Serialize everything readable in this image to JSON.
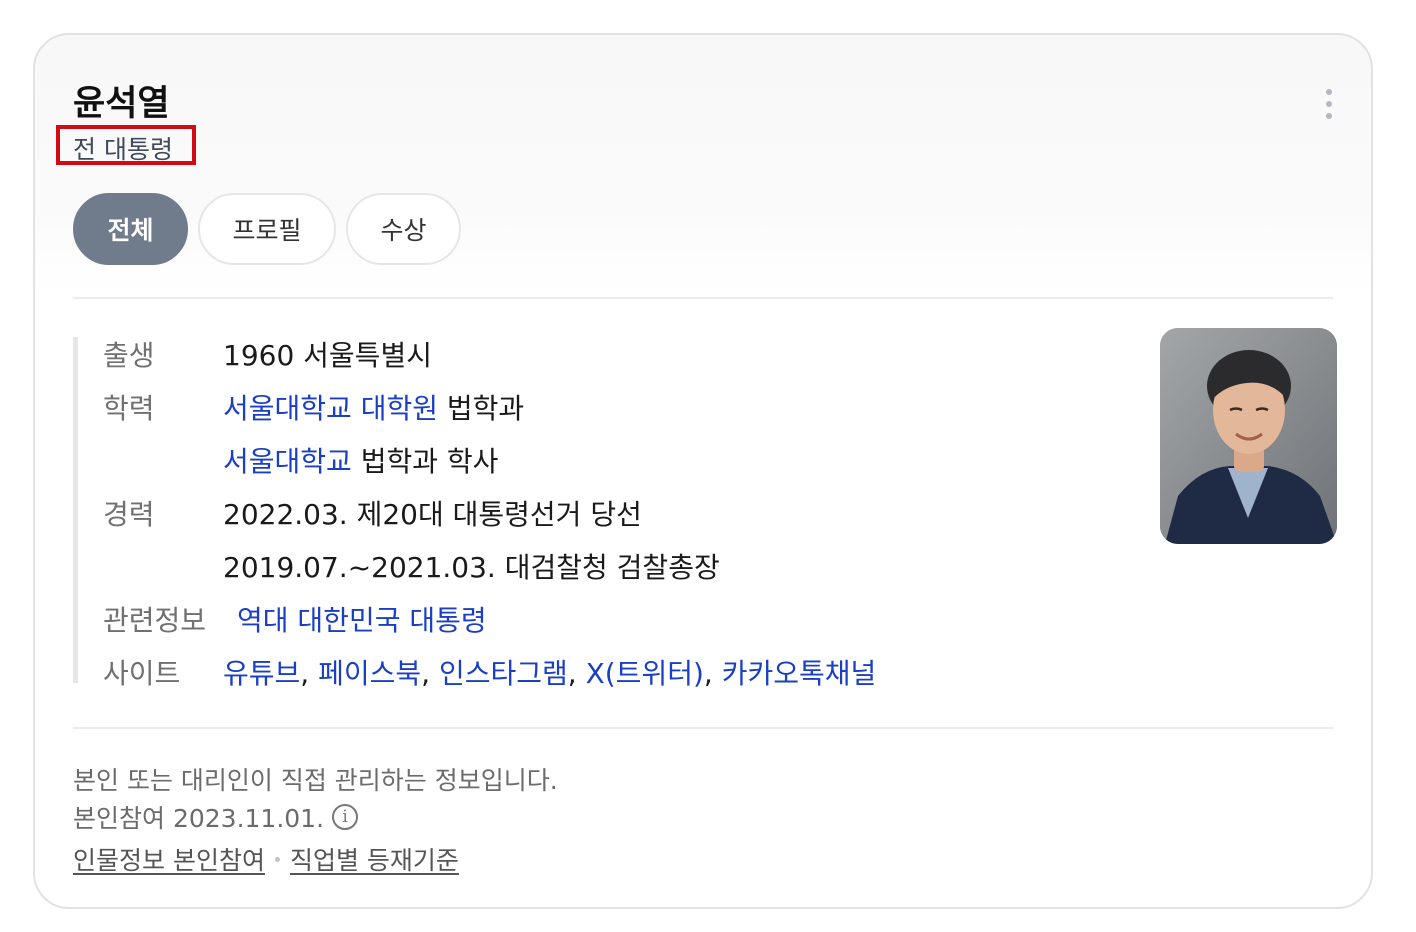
{
  "profile": {
    "name": "윤석열",
    "role": "전 대통령"
  },
  "tabs": [
    {
      "label": "전체",
      "active": true
    },
    {
      "label": "프로필",
      "active": false
    },
    {
      "label": "수상",
      "active": false
    }
  ],
  "info": {
    "birth": {
      "label": "출생",
      "value": "1960 서울특별시"
    },
    "education": {
      "label": "학력",
      "line1": {
        "school": "서울대학교",
        "grad": "대학원",
        "major": "법학과"
      },
      "line2": {
        "school": "서울대학교",
        "rest": "법학과 학사"
      }
    },
    "career": {
      "label": "경력",
      "line1": "2022.03. 제20대 대통령선거 당선",
      "line2": "2019.07.~2021.03. 대검찰청 검찰총장"
    },
    "related": {
      "label": "관련정보",
      "link": "역대 대한민국 대통령"
    },
    "sites": {
      "label": "사이트",
      "links": [
        "유튜브",
        "페이스북",
        "인스타그램",
        "X(트위터)",
        "카카오톡채널"
      ],
      "separator": ", "
    }
  },
  "footer": {
    "notice": "본인 또는 대리인이 직접 관리하는 정보입니다.",
    "participation": "본인참여 2023.11.01.",
    "info_icon": "i",
    "link1": "인물정보 본인참여",
    "link2": "직업별 등재기준"
  },
  "colors": {
    "link": "#1a3fc4",
    "active_tab": "#707c8c",
    "highlight_box": "#d10a14"
  },
  "icons": {
    "more": "more-vertical-icon",
    "info": "info-circle-icon"
  }
}
